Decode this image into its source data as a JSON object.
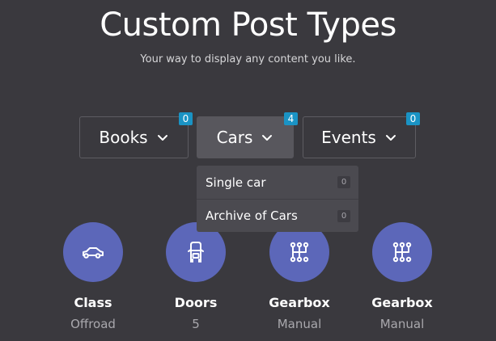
{
  "header": {
    "title": "Custom Post Types",
    "subtitle": "Your way to display any content you like."
  },
  "dropdowns": [
    {
      "label": "Books",
      "badge": "0"
    },
    {
      "label": "Cars",
      "badge": "4",
      "active": true
    },
    {
      "label": "Events",
      "badge": "0"
    }
  ],
  "menu": {
    "items": [
      {
        "label": "Single car",
        "count": "0"
      },
      {
        "label": "Archive of Cars",
        "count": "0"
      }
    ]
  },
  "features": [
    {
      "name": "Class",
      "value": "Offroad",
      "icon": "car-icon"
    },
    {
      "name": "Doors",
      "value": "5",
      "icon": "car-door-icon"
    },
    {
      "name": "Gearbox",
      "value": "Manual",
      "icon": "gear-shift-icon"
    },
    {
      "name": "Gearbox",
      "value": "Manual",
      "icon": "gear-shift-icon"
    }
  ],
  "colors": {
    "background": "#3a393e",
    "accent": "#5c67b9",
    "badge": "#1a93c4"
  }
}
